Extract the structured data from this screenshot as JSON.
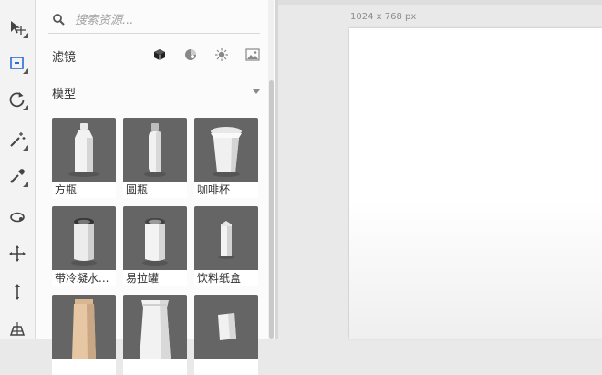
{
  "toolbar": {
    "tools": [
      {
        "name": "move-tool",
        "icon": "move-icon"
      },
      {
        "name": "select-tool",
        "icon": "select-icon"
      },
      {
        "name": "rotate-tool",
        "icon": "rotate-icon"
      },
      {
        "name": "magic-wand-tool",
        "icon": "magic-wand-icon"
      },
      {
        "name": "eyedropper-tool",
        "icon": "eyedropper-icon"
      },
      {
        "name": "orbit-tool",
        "icon": "orbit-icon"
      },
      {
        "name": "pan-tool",
        "icon": "pan-icon"
      },
      {
        "name": "dolly-tool",
        "icon": "dolly-icon"
      },
      {
        "name": "perspective-tool",
        "icon": "perspective-icon"
      }
    ]
  },
  "search": {
    "placeholder": "搜索资源..."
  },
  "filter": {
    "label": "滤镜",
    "icons": [
      "cube-icon",
      "material-icon",
      "light-icon",
      "image-icon"
    ]
  },
  "section": {
    "label": "模型"
  },
  "models": [
    {
      "label": "方瓶",
      "shape": "square-bottle"
    },
    {
      "label": "圆瓶",
      "shape": "round-bottle"
    },
    {
      "label": "咖啡杯",
      "shape": "coffee-cup"
    },
    {
      "label": "带冷凝水...",
      "shape": "condensation-can"
    },
    {
      "label": "易拉罐",
      "shape": "can"
    },
    {
      "label": "饮料纸盒",
      "shape": "carton"
    },
    {
      "label": "",
      "shape": "paper-bag"
    },
    {
      "label": "",
      "shape": "pouch"
    },
    {
      "label": "",
      "shape": "sachet"
    }
  ],
  "canvas": {
    "size_label": "1024 x 768 px"
  },
  "colors": {
    "thumb_bg": "#656565",
    "panel_bg": "#fbfbfb",
    "canvas_bg": "#e9e9e9"
  }
}
